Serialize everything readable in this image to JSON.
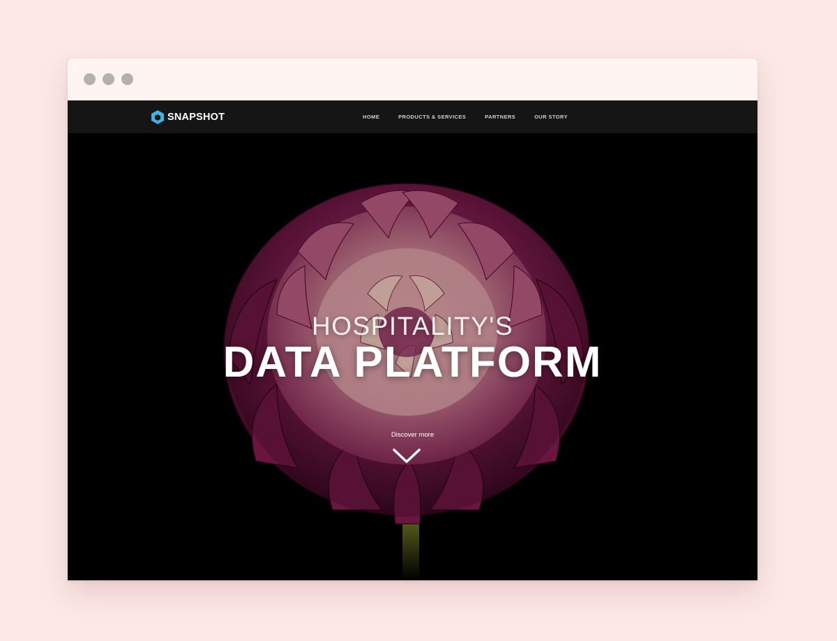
{
  "brand": {
    "name": "SNAPSHOT",
    "accent": "#3fb1e3"
  },
  "nav": {
    "items": [
      {
        "label": "HOME"
      },
      {
        "label": "PRODUCTS & SERVICES"
      },
      {
        "label": "PARTNERS"
      },
      {
        "label": "OUR STORY"
      }
    ]
  },
  "hero": {
    "line1": "HOSPITALITY'S",
    "line2": "DATA PLATFORM",
    "cta": "Discover more",
    "cta_icon": "chevron-down-icon",
    "background": "#000000",
    "flower_color": "#7a1c4c"
  },
  "page_background": "#fce8e6"
}
